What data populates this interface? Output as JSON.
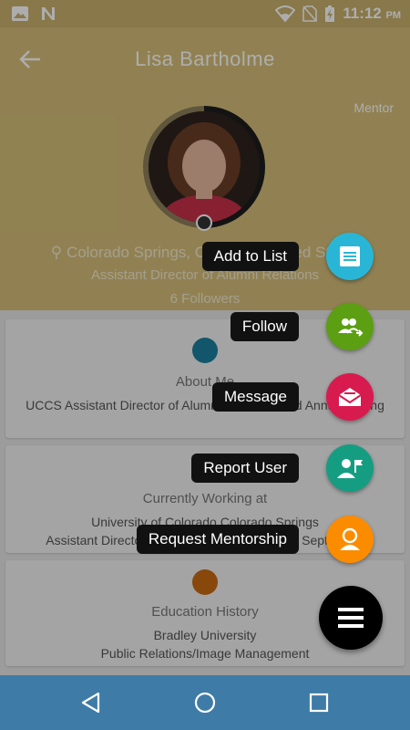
{
  "status_bar": {
    "time": "11:12",
    "ampm": "PM"
  },
  "header": {
    "title": "Lisa  Bartholme",
    "role_tag": "Mentor",
    "location": "Colorado Springs, Colorado, United States",
    "job_title": "Assistant Director of Alumni Relations",
    "followers": "6 Followers"
  },
  "cards": {
    "about": {
      "title": "About Me",
      "text": "UCCS Assistant Director of Alumni Relations and Annual Giving"
    },
    "work": {
      "title": "Currently Working at",
      "line1": "University of Colorado Colorado Springs",
      "line2": "Assistant Director of Alumni Relations (Since Sept 2015)"
    },
    "education": {
      "title": "Education History",
      "line1": "Bradley University",
      "line2": "Public Relations/Image Management"
    }
  },
  "fab_menu": [
    {
      "label": "Add to List",
      "icon": "list-icon",
      "color": "#29b6d6"
    },
    {
      "label": "Follow",
      "icon": "group-follow-icon",
      "color": "#5c9f12"
    },
    {
      "label": "Message",
      "icon": "mail-icon",
      "color": "#d81b4f"
    },
    {
      "label": "Report User",
      "icon": "report-flag-icon",
      "color": "#159d82"
    },
    {
      "label": "Request Mentorship",
      "icon": "person-icon",
      "color": "#fb8c00"
    }
  ],
  "colors": {
    "header_bg": "#d6bf79",
    "navbar_bg": "#3e7ba7",
    "main_fab": "#000000"
  }
}
